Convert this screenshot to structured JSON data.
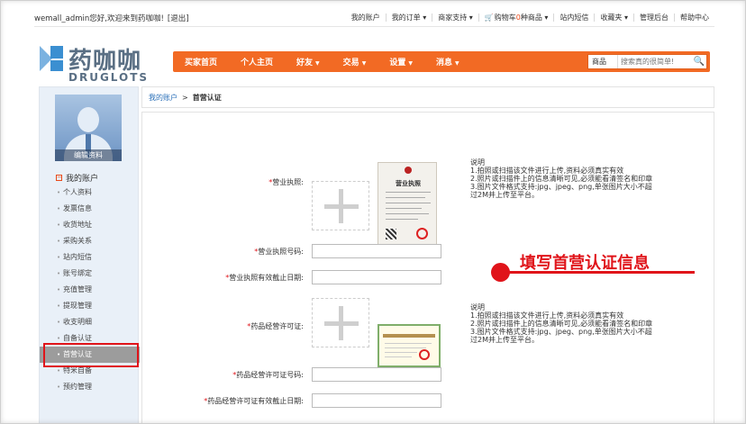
{
  "topbar": {
    "welcome": "wemall_admin您好,欢迎来到药咖咖!",
    "logout": "[退出]",
    "links": [
      "我的账户",
      "我的订单 ▾",
      "商家支持 ▾",
      "购物车",
      "种商品 ▾",
      "站内短信",
      "收藏夹 ▾",
      "管理后台",
      "帮助中心"
    ],
    "cart_count": "0"
  },
  "logo": {
    "cn": "药咖咖",
    "en": "DRUGLOTS"
  },
  "nav": {
    "items": [
      "买家首页",
      "个人主页",
      "好友",
      "交易",
      "设置",
      "消息"
    ],
    "search_category": "商品",
    "search_placeholder": "搜索真的很简单!"
  },
  "sidebar": {
    "edit_profile": "编辑资料",
    "section_title": "我的账户",
    "items": [
      "个人资料",
      "发票信息",
      "收货地址",
      "采购关系",
      "站内短信",
      "账号绑定",
      "充值管理",
      "提现管理",
      "收支明细",
      "自备认证",
      "首营认证",
      "特米自备",
      "预约管理"
    ]
  },
  "breadcrumb": {
    "root": "我的账户",
    "sep": ">",
    "current": "首营认证"
  },
  "form": {
    "business_license": "营业执照:",
    "business_license_no": "营业执照号码:",
    "business_license_expiry": "营业执照有效截止日期:",
    "drug_permit": "药品经营许可证:",
    "drug_permit_no": "药品经营许可证号码:",
    "drug_permit_expiry": "药品经营许可证有效截止日期:",
    "license_image_title": "营业执照"
  },
  "notes": {
    "title": "说明",
    "line1": "1.拍照或扫描该文件进行上传,资料必须真实有效",
    "line2": "2.照片或扫描件上的信息清晰可见,必须能看清签名和印章",
    "line3": "3.图片文件格式支持:jpg、jpeg、png,单张图片大小不超过2M并上传至平台。"
  },
  "annotation": "填写首营认证信息",
  "colors": {
    "nav_orange": "#f26a24",
    "annotation_red": "#e0141a",
    "sidebar_bg": "#e9f0f8",
    "logo_blue": "#5a6f84"
  }
}
